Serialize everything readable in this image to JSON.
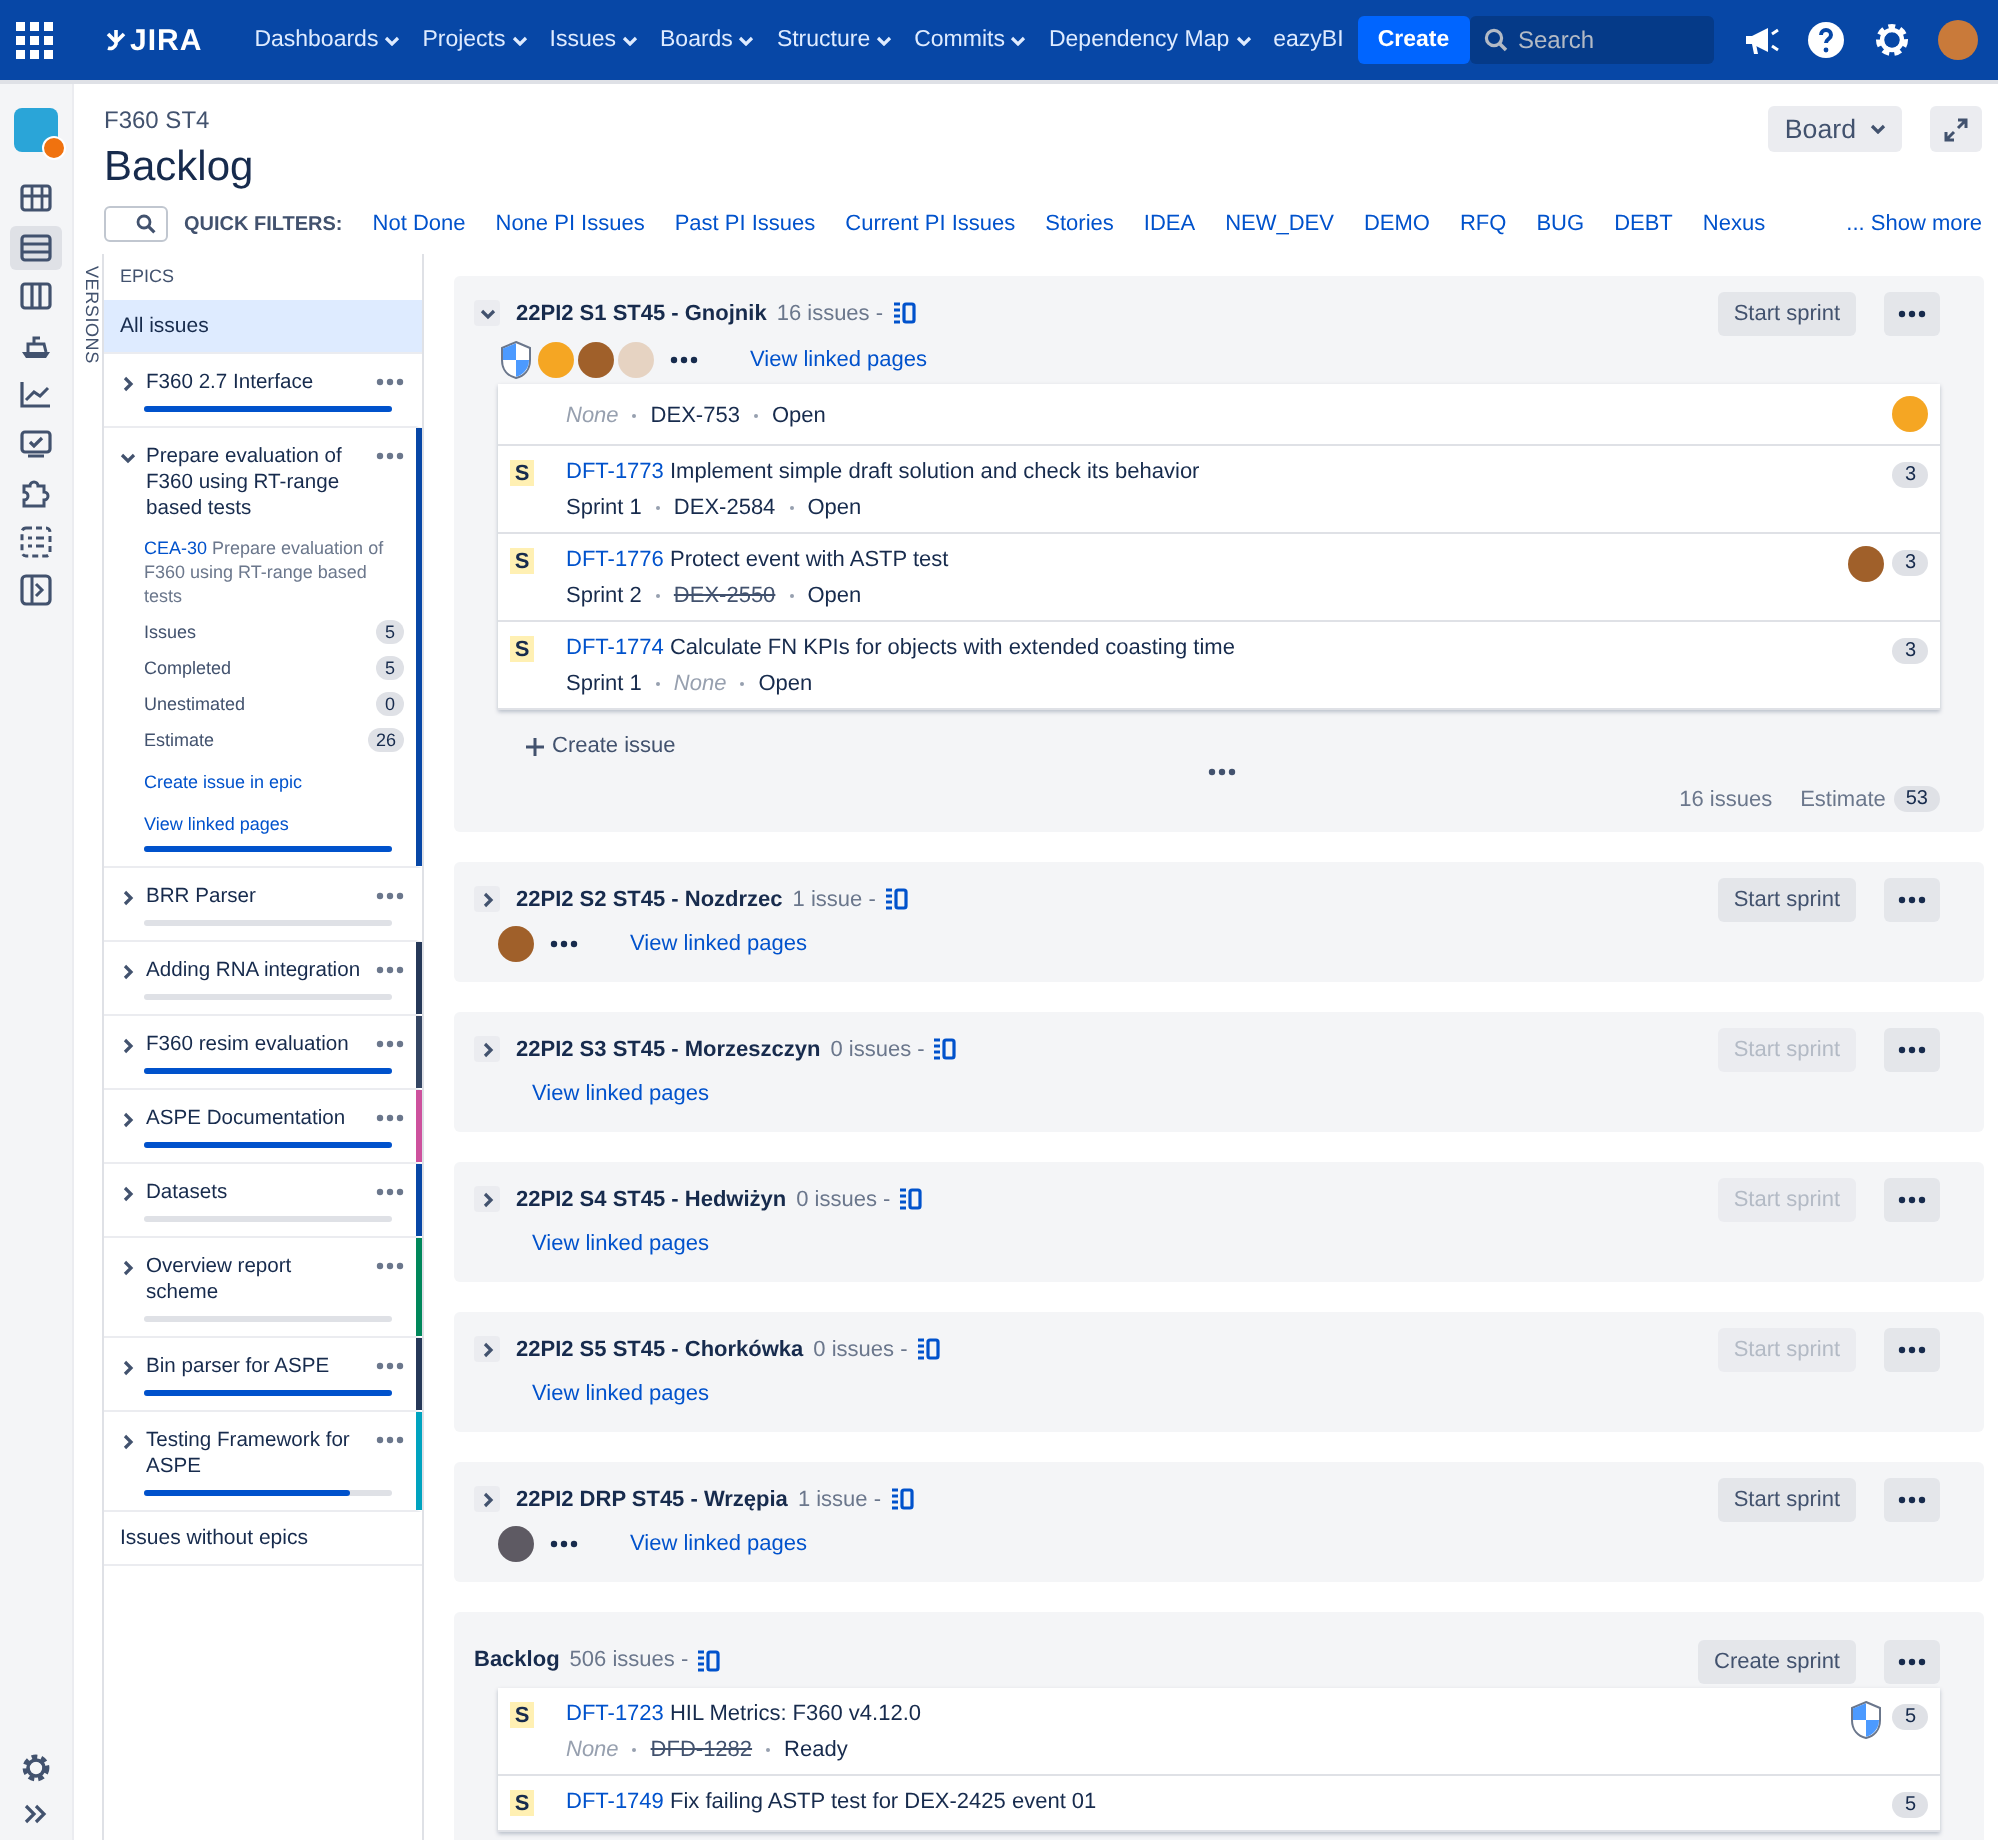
{
  "nav": {
    "logo": "JIRA",
    "menus": [
      {
        "label": "Dashboards",
        "dropdown": true
      },
      {
        "label": "Projects",
        "dropdown": true
      },
      {
        "label": "Issues",
        "dropdown": true
      },
      {
        "label": "Boards",
        "dropdown": true
      },
      {
        "label": "Structure",
        "dropdown": true
      },
      {
        "label": "Commits",
        "dropdown": true
      },
      {
        "label": "Dependency Map",
        "dropdown": true
      },
      {
        "label": "eazyBI",
        "dropdown": false
      }
    ],
    "create": "Create",
    "search": {
      "placeholder": "Search"
    }
  },
  "rail": {
    "items": [
      {
        "kind": "board",
        "selected": false
      },
      {
        "kind": "backlog",
        "selected": true
      },
      {
        "kind": "columns",
        "selected": false
      },
      {
        "kind": "boat",
        "selected": false
      },
      {
        "kind": "chart",
        "selected": false
      },
      {
        "kind": "monitor",
        "selected": false
      },
      {
        "kind": "puzzle",
        "selected": false
      },
      {
        "kind": "checklist",
        "selected": false
      },
      {
        "kind": "page",
        "selected": false
      }
    ]
  },
  "header": {
    "project": "F360 ST4",
    "title": "Backlog",
    "board_button": "Board",
    "quick_filters_label": "QUICK FILTERS:",
    "quick_filters": [
      "Not Done",
      "None PI Issues",
      "Past PI Issues",
      "Current PI Issues",
      "Stories",
      "IDEA",
      "NEW_DEV",
      "DEMO",
      "RFQ",
      "BUG",
      "DEBT",
      "Nexus"
    ],
    "show_more": "... Show more"
  },
  "versions_tab": "VERSIONS",
  "epics": {
    "heading": "EPICS",
    "all_issues": {
      "label": "All issues",
      "selected": true
    },
    "items": [
      {
        "name": "F360 2.7 Interface",
        "expanded": false,
        "level": 1
      },
      {
        "name": "Prepare evaluation of F360 using RT-range based tests",
        "expanded": true,
        "level": 1,
        "color": "#0747a6",
        "detail": {
          "key": "CEA-30",
          "summary": "Prepare evaluation of F360 using RT-range based tests",
          "stats": [
            {
              "label": "Issues",
              "value": "5"
            },
            {
              "label": "Completed",
              "value": "5"
            },
            {
              "label": "Unestimated",
              "value": "0"
            },
            {
              "label": "Estimate",
              "value": "26"
            }
          ],
          "links": [
            "Create issue in epic",
            "View linked pages"
          ]
        }
      },
      {
        "name": "BRR Parser",
        "expanded": false,
        "level": 0
      },
      {
        "name": "Adding RNA integration",
        "expanded": false,
        "level": 0,
        "color": "#253858"
      },
      {
        "name": "F360 resim evaluation",
        "expanded": false,
        "level": 1,
        "color": "#344563"
      },
      {
        "name": "ASPE Documentation",
        "expanded": false,
        "level": 1,
        "color": "#cd519d"
      },
      {
        "name": "Datasets",
        "expanded": false,
        "level": 0,
        "color": "#0747a6"
      },
      {
        "name": "Overview report scheme",
        "expanded": false,
        "level": 0,
        "color": "#00875a"
      },
      {
        "name": "Bin parser for ASPE",
        "expanded": false,
        "level": 1,
        "color": "#253858"
      },
      {
        "name": "Testing Framework for ASPE",
        "expanded": false,
        "level": 0.83,
        "color": "#00a3bf"
      }
    ],
    "issues_without_epics": {
      "label": "Issues without epics",
      "selected": false
    }
  },
  "sprints": [
    {
      "name": "22PI2 S1 ST45 - Gnojnik",
      "count": "16 issues -",
      "expanded": true,
      "avatars": [
        {
          "kind": "shield"
        },
        {
          "kind": "photo",
          "color": "#f5a623"
        },
        {
          "kind": "photo",
          "color": "#a0602a"
        },
        {
          "kind": "photo",
          "color": "#e6d3c2"
        }
      ],
      "more_avatars": true,
      "link": "View linked pages",
      "button": {
        "label": "Start sprint",
        "disabled": false
      },
      "issues": [
        {
          "meta": [
            {
              "text": "None",
              "kind": "empty"
            },
            {
              "text": "DEX-753",
              "kind": "plain"
            },
            {
              "text": "Open",
              "kind": "plain"
            }
          ],
          "avatar": {
            "kind": "photo",
            "color": "#f5a623"
          }
        },
        {
          "type": "S",
          "key": "DFT-1773",
          "summary": "Implement simple draft solution and check its behavior",
          "meta": [
            {
              "text": "Sprint 1",
              "kind": "plain"
            },
            {
              "text": "DEX-2584",
              "kind": "plain"
            },
            {
              "text": "Open",
              "kind": "plain"
            }
          ],
          "points": "3"
        },
        {
          "type": "S",
          "key": "DFT-1776",
          "summary": "Protect event with ASTP test",
          "meta": [
            {
              "text": "Sprint 2",
              "kind": "plain"
            },
            {
              "text": "DEX-2550",
              "kind": "done"
            },
            {
              "text": "Open",
              "kind": "plain"
            }
          ],
          "points": "3",
          "avatar": {
            "kind": "photo",
            "color": "#a0602a"
          }
        },
        {
          "type": "S",
          "key": "DFT-1774",
          "summary": "Calculate FN KPIs for objects with extended coasting time",
          "meta": [
            {
              "text": "Sprint 1",
              "kind": "plain"
            },
            {
              "text": "None",
              "kind": "empty"
            },
            {
              "text": "Open",
              "kind": "plain"
            }
          ],
          "points": "3"
        }
      ],
      "create_issue": "Create issue",
      "footer": {
        "count": "16 issues",
        "estimate_label": "Estimate",
        "estimate": "53"
      }
    },
    {
      "name": "22PI2 S2 ST45 - Nozdrzec",
      "count": "1 issue -",
      "expanded": false,
      "avatars": [
        {
          "kind": "photo",
          "color": "#a0602a"
        }
      ],
      "more_avatars": true,
      "link": "View linked pages",
      "button": {
        "label": "Start sprint",
        "disabled": false
      }
    },
    {
      "name": "22PI2 S3 ST45 - Morzeszczyn",
      "count": "0 issues -",
      "expanded": false,
      "link": "View linked pages",
      "button": {
        "label": "Start sprint",
        "disabled": true
      }
    },
    {
      "name": "22PI2 S4 ST45 - Hedwiżyn",
      "count": "0 issues -",
      "expanded": false,
      "link": "View linked pages",
      "button": {
        "label": "Start sprint",
        "disabled": true
      }
    },
    {
      "name": "22PI2 S5 ST45 - Chorkówka",
      "count": "0 issues -",
      "expanded": false,
      "link": "View linked pages",
      "button": {
        "label": "Start sprint",
        "disabled": true
      }
    },
    {
      "name": "22PI2 DRP ST45 - Wrzępia",
      "count": "1 issue -",
      "expanded": false,
      "avatars": [
        {
          "kind": "photo",
          "color": "#5e5a63"
        }
      ],
      "more_avatars": true,
      "link": "View linked pages",
      "button": {
        "label": "Start sprint",
        "disabled": false
      }
    }
  ],
  "backlog": {
    "name": "Backlog",
    "count": "506 issues -",
    "button": {
      "label": "Create sprint",
      "disabled": false
    },
    "issues": [
      {
        "type": "S",
        "key": "DFT-1723",
        "summary": "HIL Metrics: F360 v4.12.0",
        "meta": [
          {
            "text": "None",
            "kind": "empty"
          },
          {
            "text": "DFD-1282",
            "kind": "done"
          },
          {
            "text": "Ready",
            "kind": "plain"
          }
        ],
        "points": "5",
        "avatar": {
          "kind": "shield"
        }
      },
      {
        "type": "S",
        "key": "DFT-1749",
        "summary": "Fix failing ASTP test for DEX-2425 event 01",
        "points": "5"
      }
    ]
  }
}
